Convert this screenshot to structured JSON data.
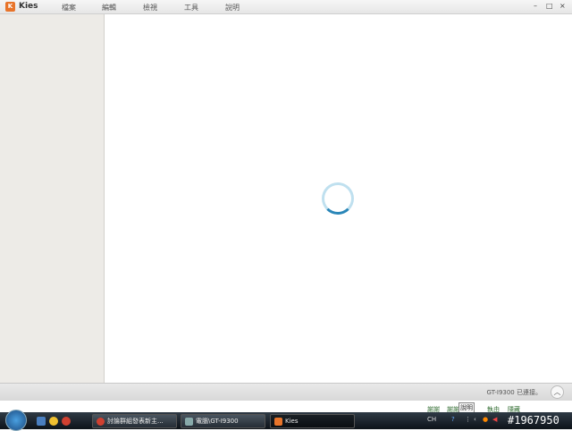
{
  "window": {
    "title": "Kies",
    "menu": [
      "檔案",
      "編輯",
      "檢視",
      "工具",
      "說明"
    ]
  },
  "status": {
    "text": "GT-I9300 已連接。"
  },
  "background_window": {
    "items": [
      "謝謝",
      "謝謝",
      "執由",
      "隱藏"
    ],
    "tooltip": "說明"
  },
  "taskbar": {
    "tasks": [
      "討論群組發表新主...",
      "電腦\\GT-I9300",
      "Kies"
    ],
    "lang": "CH",
    "watermark": "#1967950"
  }
}
